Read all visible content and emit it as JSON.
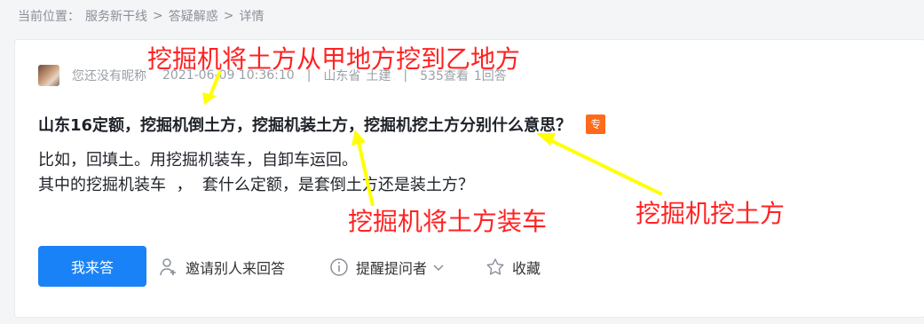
{
  "breadcrumb": {
    "label": "当前位置：",
    "items": [
      "服务新干线",
      "答疑解惑",
      "详情"
    ],
    "separator": ">"
  },
  "question": {
    "author": "您还没有昵称",
    "datetime": "2021-06-09 10:36:10",
    "separator": "|",
    "location": "山东省",
    "category": "土建",
    "views": "535查看",
    "answers": "1回答",
    "title": "山东16定额，挖掘机倒土方，挖掘机装土方，挖掘机挖土方分别什么意思？",
    "badge": "专",
    "body_line1": "比如，回填土。用挖掘机装车，自卸车运回。",
    "body_line2": "其中的挖掘机装车  ，  套什么定额，是套倒土方还是装土方？"
  },
  "actions": {
    "answer_label": "我来答",
    "invite_label": "邀请别人来回答",
    "remind_label": "提醒提问者",
    "favorite_label": "收藏"
  },
  "annotations": {
    "a1": "挖掘机将土方从甲地方挖到乙地方",
    "a2": "挖掘机将土方装车",
    "a3": "挖掘机挖土方",
    "color": "#ff2222",
    "arrow_color": "#ffff00"
  }
}
